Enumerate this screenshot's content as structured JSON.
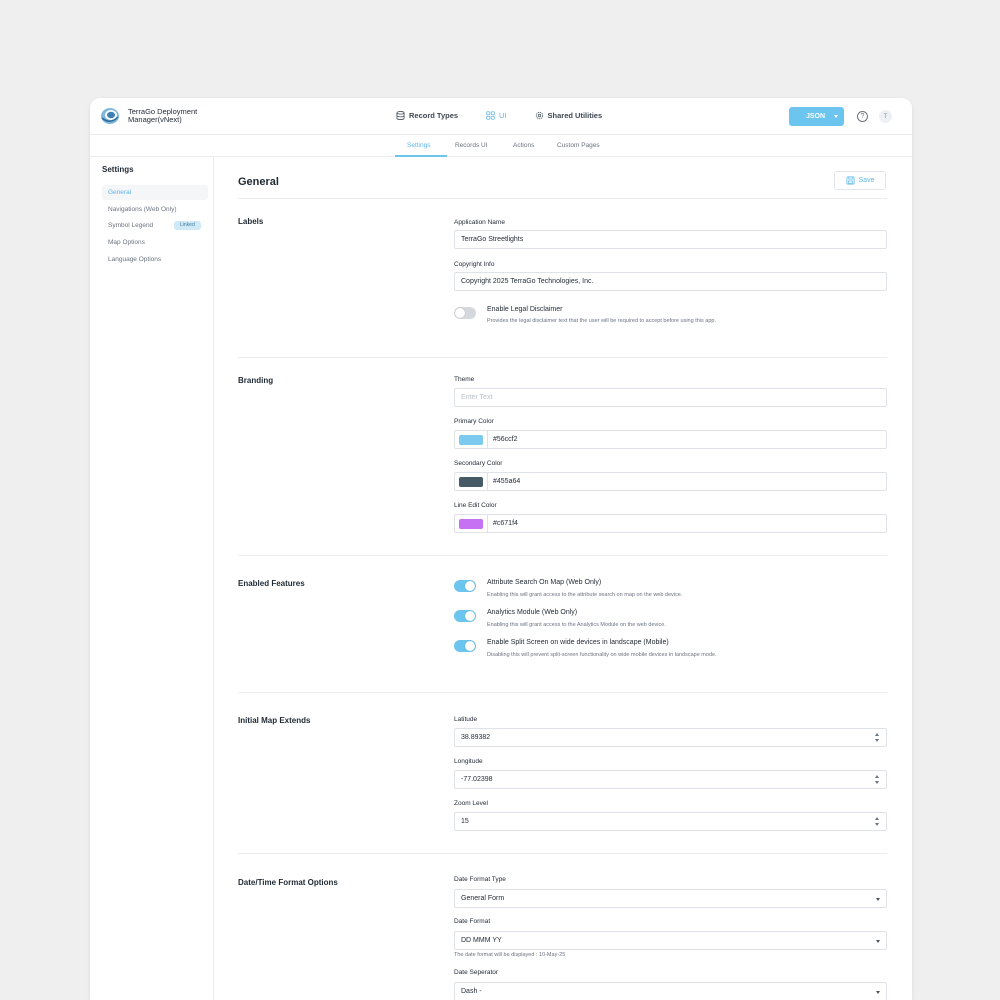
{
  "app": {
    "name": "TerraGo Deployment Manager(vNext)"
  },
  "nav": {
    "items": [
      {
        "label": "Record Types",
        "icon": "database-icon"
      },
      {
        "label": "UI",
        "icon": "ui-icon"
      },
      {
        "label": "Shared Utilities",
        "icon": "gear-icon"
      }
    ],
    "json_label": "JSON",
    "help_icon": "?",
    "avatar_initial": "T"
  },
  "subtabs": [
    "Settings",
    "Records UI",
    "Actions",
    "Custom Pages"
  ],
  "sidebar": {
    "title": "Settings",
    "items": [
      {
        "label": "General"
      },
      {
        "label": "Navigations (Web Only)"
      },
      {
        "label": "Symbol Legend",
        "badge": "Linked"
      },
      {
        "label": "Map Options"
      },
      {
        "label": "Language Options"
      }
    ]
  },
  "main": {
    "title": "General",
    "save_label": "Save",
    "labels": {
      "title": "Labels",
      "app_name_label": "Application Name",
      "app_name_value": "TerraGo Streetlights",
      "copyright_label": "Copyright Info",
      "copyright_value": "Copyright 2025 TerraGo Technologies, Inc.",
      "disclaimer_title": "Enable Legal Disclaimer",
      "disclaimer_desc": "Provides the legal disclaimer text that the user will be required to accept before using this app.",
      "disclaimer_on": false
    },
    "branding": {
      "title": "Branding",
      "theme_label": "Theme",
      "theme_placeholder": "Enter Text",
      "primary_label": "Primary Color",
      "primary_value": "#56ccf2",
      "secondary_label": "Secondary Color",
      "secondary_value": "#455a64",
      "line_edit_label": "Line Edit Color",
      "line_edit_value": "#c671f4"
    },
    "features": {
      "title": "Enabled Features",
      "items": [
        {
          "title": "Attribute Search On Map (Web Only)",
          "desc": "Enabling this will grant access to the attribute search on map on the web device.",
          "on": true
        },
        {
          "title": "Analytics Module (Web Only)",
          "desc": "Enabling this will grant access to the Analytics Module on the web device.",
          "on": true
        },
        {
          "title": "Enable Split Screen on wide devices in landscape (Mobile)",
          "desc": "Disabling this will prevent split-screen functionality on wide mobile devices in landscape mode.",
          "on": true
        }
      ]
    },
    "map_extends": {
      "title": "Initial Map Extends",
      "latitude_label": "Latitude",
      "latitude_value": "38.89382",
      "longitude_label": "Longitude",
      "longitude_value": "-77.02398",
      "zoom_label": "Zoom Level",
      "zoom_value": "15"
    },
    "datetime": {
      "title": "Date/Time Format Options",
      "format_type_label": "Date Format Type",
      "format_type_value": "General Form",
      "format_label": "Date Format",
      "format_value": "DD MMM YY",
      "format_hint": "The date format will be displayed : 10-May-25",
      "separator_label": "Date Seperator",
      "separator_value": "Dash -"
    }
  }
}
